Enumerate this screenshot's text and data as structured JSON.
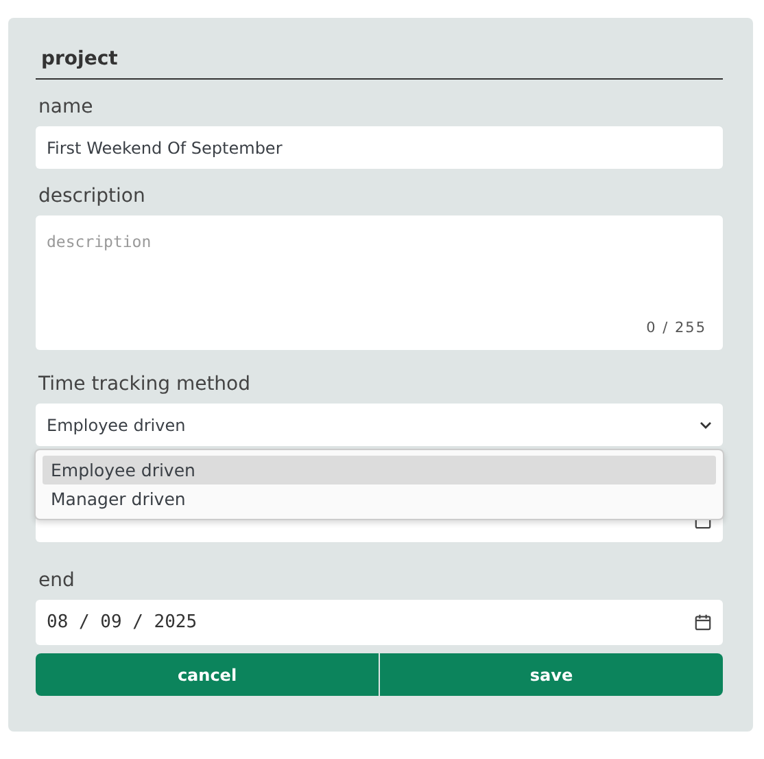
{
  "form": {
    "title": "project",
    "name": {
      "label": "name",
      "value": "First Weekend Of September"
    },
    "description": {
      "label": "description",
      "placeholder": "description",
      "counter": "0 / 255"
    },
    "tracking": {
      "label": "Time tracking method",
      "value": "Employee driven",
      "expanded": true,
      "options": [
        {
          "label": "Employee driven",
          "selected": true
        },
        {
          "label": "Manager driven",
          "selected": false
        }
      ]
    },
    "end": {
      "label": "end",
      "value": "08 / 09 / 2025"
    },
    "buttons": [
      "cancel",
      "save"
    ]
  }
}
